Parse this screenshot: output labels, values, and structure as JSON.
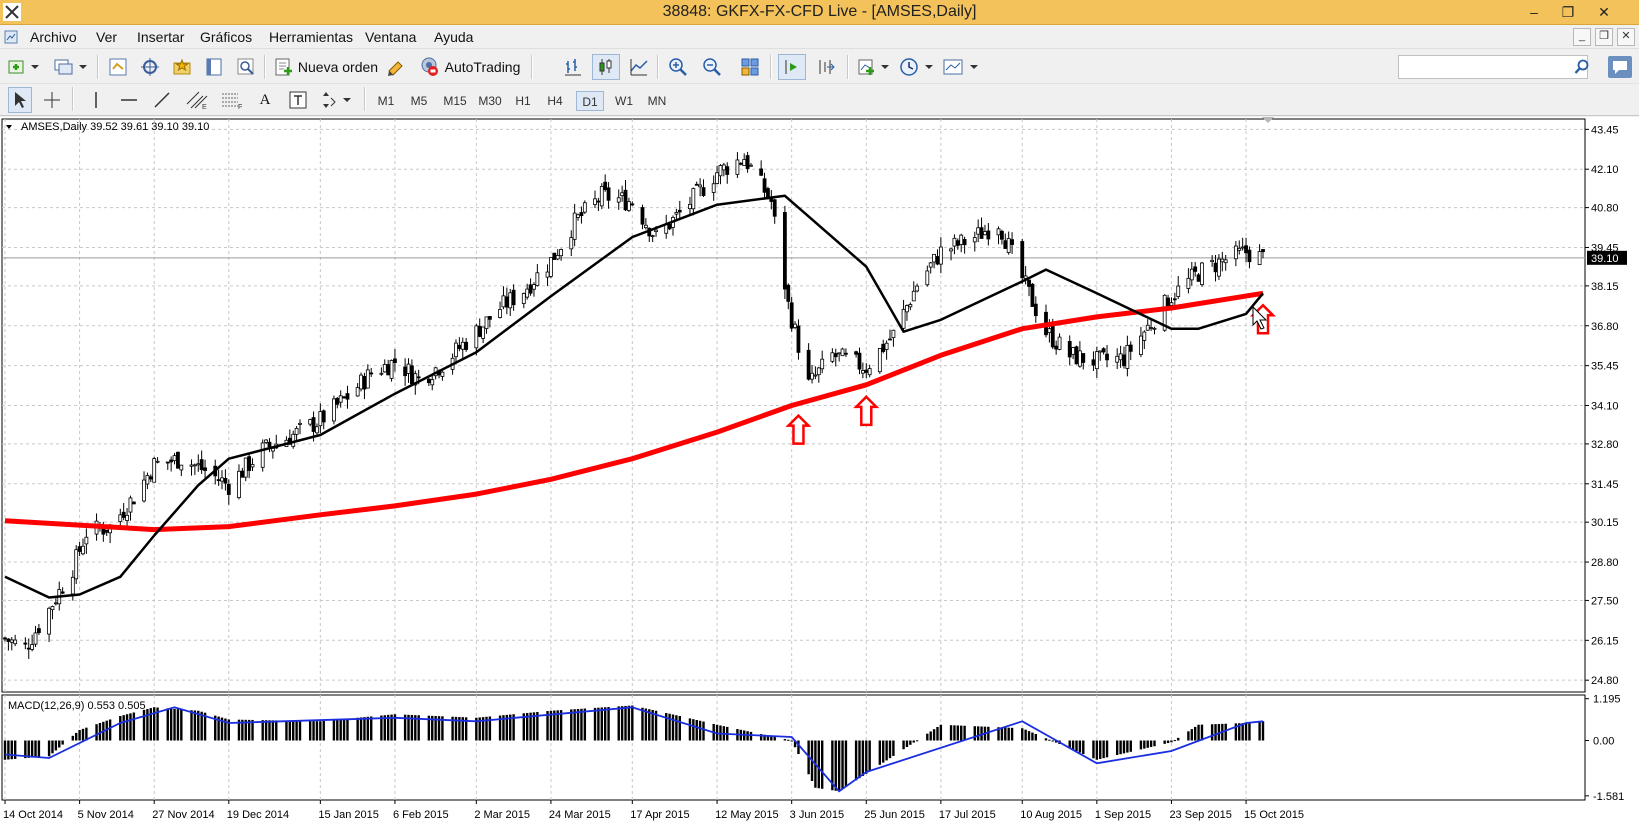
{
  "window": {
    "title": "38848: GKFX-FX-CFD Live - [AMSES,Daily]",
    "minimize": "–",
    "restore": "❐",
    "close": "✕"
  },
  "menu": {
    "items": [
      "Archivo",
      "Ver",
      "Insertar",
      "Gráficos",
      "Herramientas",
      "Ventana",
      "Ayuda"
    ]
  },
  "toolbar": {
    "new_order": "Nueva orden",
    "autotrading": "AutoTrading",
    "text_tool": "A",
    "timeframes": [
      "M1",
      "M5",
      "M15",
      "M30",
      "H1",
      "H4",
      "D1",
      "W1",
      "MN"
    ],
    "active_timeframe": "D1"
  },
  "chart": {
    "info_label": "AMSES,Daily  39.52 39.61 39.10 39.10",
    "current_price": "39.10",
    "price_ticks": [
      "43.45",
      "42.10",
      "40.80",
      "39.45",
      "38.15",
      "36.80",
      "35.45",
      "34.10",
      "32.80",
      "31.45",
      "30.15",
      "28.80",
      "27.50",
      "26.15",
      "24.80"
    ],
    "macd_label": "MACD(12,26,9) 0.553 0.505",
    "macd_ticks": [
      "1.195",
      "0.00",
      "-1.581"
    ],
    "date_ticks": [
      "14 Oct 2014",
      "5 Nov 2014",
      "27 Nov 2014",
      "19 Dec 2014",
      "15 Jan 2015",
      "6 Feb 2015",
      "2 Mar 2015",
      "24 Mar 2015",
      "17 Apr 2015",
      "12 May 2015",
      "3 Jun 2015",
      "25 Jun 2015",
      "17 Jul 2015",
      "10 Aug 2015",
      "1 Sep 2015",
      "23 Sep 2015",
      "15 Oct 2015"
    ],
    "colors": {
      "sma_slow": "#ff0000",
      "sma_fast": "#000000",
      "macd_signal": "#1a2ee0",
      "arrows": "#ff0000",
      "grid": "#c8c8c8"
    }
  },
  "chart_data": {
    "type": "candlestick",
    "symbol": "AMSES",
    "timeframe": "Daily",
    "last_ohlc": {
      "open": 39.52,
      "high": 39.61,
      "low": 39.1,
      "close": 39.1
    },
    "ylim": [
      24.4,
      43.8
    ],
    "close_path": [
      [
        "14 Oct 2014",
        26.2
      ],
      [
        "20 Oct 2014",
        25.9
      ],
      [
        "27 Oct 2014",
        27.2
      ],
      [
        "3 Nov 2014",
        28.6
      ],
      [
        "7 Nov 2014",
        29.8
      ],
      [
        "14 Nov 2014",
        30.0
      ],
      [
        "21 Nov 2014",
        31.0
      ],
      [
        "27 Nov 2014",
        32.1
      ],
      [
        "5 Dec 2014",
        32.3
      ],
      [
        "12 Dec 2014",
        31.9
      ],
      [
        "19 Dec 2014",
        31.4
      ],
      [
        "29 Dec 2014",
        32.6
      ],
      [
        "7 Jan 2015",
        33.1
      ],
      [
        "15 Jan 2015",
        33.6
      ],
      [
        "23 Jan 2015",
        34.4
      ],
      [
        "30 Jan 2015",
        35.2
      ],
      [
        "6 Feb 2015",
        35.6
      ],
      [
        "13 Feb 2015",
        35.0
      ],
      [
        "20 Feb 2015",
        35.5
      ],
      [
        "2 Mar 2015",
        36.6
      ],
      [
        "9 Mar 2015",
        37.4
      ],
      [
        "16 Mar 2015",
        38.0
      ],
      [
        "24 Mar 2015",
        39.0
      ],
      [
        "31 Mar 2015",
        40.3
      ],
      [
        "8 Apr 2015",
        41.2
      ],
      [
        "17 Apr 2015",
        41.0
      ],
      [
        "24 Apr 2015",
        39.8
      ],
      [
        "1 May 2015",
        40.6
      ],
      [
        "12 May 2015",
        42.0
      ],
      [
        "20 May 2015",
        42.5
      ],
      [
        "28 May 2015",
        41.0
      ],
      [
        "2 Jun 2015",
        37.5
      ],
      [
        "8 Jun 2015",
        34.8
      ],
      [
        "15 Jun 2015",
        35.8
      ],
      [
        "25 Jun 2015",
        35.4
      ],
      [
        "3 Jul 2015",
        36.5
      ],
      [
        "10 Jul 2015",
        38.2
      ],
      [
        "17 Jul 2015",
        39.3
      ],
      [
        "27 Jul 2015",
        39.8
      ],
      [
        "3 Aug 2015",
        40.3
      ],
      [
        "10 Aug 2015",
        38.4
      ],
      [
        "17 Aug 2015",
        36.6
      ],
      [
        "24 Aug 2015",
        35.8
      ],
      [
        "1 Sep 2015",
        35.6
      ],
      [
        "9 Sep 2015",
        35.7
      ],
      [
        "17 Sep 2015",
        36.9
      ],
      [
        "23 Sep 2015",
        37.8
      ],
      [
        "1 Oct 2015",
        38.6
      ],
      [
        "8 Oct 2015",
        39.0
      ],
      [
        "15 Oct 2015",
        39.3
      ],
      [
        "20 Oct 2015",
        39.1
      ]
    ],
    "series": [
      {
        "name": "sma_slow",
        "points": [
          [
            "14 Oct 2014",
            30.2
          ],
          [
            "27 Nov 2014",
            29.9
          ],
          [
            "19 Dec 2014",
            30.0
          ],
          [
            "15 Jan 2015",
            30.4
          ],
          [
            "6 Feb 2015",
            30.7
          ],
          [
            "2 Mar 2015",
            31.1
          ],
          [
            "24 Mar 2015",
            31.6
          ],
          [
            "17 Apr 2015",
            32.3
          ],
          [
            "12 May 2015",
            33.2
          ],
          [
            "3 Jun 2015",
            34.1
          ],
          [
            "25 Jun 2015",
            34.8
          ],
          [
            "17 Jul 2015",
            35.8
          ],
          [
            "10 Aug 2015",
            36.7
          ],
          [
            "1 Sep 2015",
            37.1
          ],
          [
            "23 Sep 2015",
            37.4
          ],
          [
            "20 Oct 2015",
            37.9
          ]
        ]
      },
      {
        "name": "sma_fast",
        "points": [
          [
            "14 Oct 2014",
            28.3
          ],
          [
            "27 Oct 2014",
            27.6
          ],
          [
            "5 Nov 2014",
            27.7
          ],
          [
            "17 Nov 2014",
            28.3
          ],
          [
            "27 Nov 2014",
            29.7
          ],
          [
            "10 Dec 2014",
            31.4
          ],
          [
            "19 Dec 2014",
            32.3
          ],
          [
            "15 Jan 2015",
            33.1
          ],
          [
            "6 Feb 2015",
            34.5
          ],
          [
            "2 Mar 2015",
            35.9
          ],
          [
            "24 Mar 2015",
            37.8
          ],
          [
            "17 Apr 2015",
            39.8
          ],
          [
            "12 May 2015",
            40.9
          ],
          [
            "1 Jun 2015",
            41.2
          ],
          [
            "25 Jun 2015",
            38.8
          ],
          [
            "6 Jul 2015",
            36.6
          ],
          [
            "17 Jul 2015",
            37.0
          ],
          [
            "10 Aug 2015",
            38.3
          ],
          [
            "17 Aug 2015",
            38.7
          ],
          [
            "1 Sep 2015",
            37.9
          ],
          [
            "23 Sep 2015",
            36.7
          ],
          [
            "1 Oct 2015",
            36.7
          ],
          [
            "15 Oct 2015",
            37.2
          ],
          [
            "20 Oct 2015",
            37.9
          ]
        ]
      }
    ],
    "macd": {
      "ylim": [
        -1.7,
        1.3
      ],
      "histogram": [
        [
          "14 Oct 2014",
          -0.55
        ],
        [
          "27 Oct 2014",
          -0.45
        ],
        [
          "5 Nov 2014",
          0.3
        ],
        [
          "17 Nov 2014",
          0.7
        ],
        [
          "27 Nov 2014",
          0.95
        ],
        [
          "10 Dec 2014",
          0.85
        ],
        [
          "19 Dec 2014",
          0.6
        ],
        [
          "15 Jan 2015",
          0.55
        ],
        [
          "6 Feb 2015",
          0.75
        ],
        [
          "2 Mar 2015",
          0.65
        ],
        [
          "24 Mar 2015",
          0.85
        ],
        [
          "17 Apr 2015",
          1.0
        ],
        [
          "1 May 2015",
          0.7
        ],
        [
          "12 May 2015",
          0.45
        ],
        [
          "3 Jun 2015",
          0.0
        ],
        [
          "10 Jun 2015",
          -1.35
        ],
        [
          "17 Jun 2015",
          -1.45
        ],
        [
          "25 Jun 2015",
          -0.95
        ],
        [
          "17 Jul 2015",
          0.45
        ],
        [
          "10 Aug 2015",
          0.35
        ],
        [
          "1 Sep 2015",
          -0.55
        ],
        [
          "23 Sep 2015",
          -0.05
        ],
        [
          "1 Oct 2015",
          0.45
        ],
        [
          "15 Oct 2015",
          0.5
        ],
        [
          "20 Oct 2015",
          0.55
        ]
      ],
      "signal": [
        [
          "14 Oct 2014",
          -0.4
        ],
        [
          "27 Oct 2014",
          -0.5
        ],
        [
          "17 Nov 2014",
          0.5
        ],
        [
          "3 Dec 2014",
          0.95
        ],
        [
          "19 Dec 2014",
          0.5
        ],
        [
          "6 Feb 2015",
          0.65
        ],
        [
          "2 Mar 2015",
          0.55
        ],
        [
          "17 Apr 2015",
          0.95
        ],
        [
          "12 May 2015",
          0.2
        ],
        [
          "3 Jun 2015",
          0.1
        ],
        [
          "17 Jun 2015",
          -1.45
        ],
        [
          "25 Jun 2015",
          -0.9
        ],
        [
          "10 Aug 2015",
          0.55
        ],
        [
          "1 Sep 2015",
          -0.65
        ],
        [
          "23 Sep 2015",
          -0.3
        ],
        [
          "15 Oct 2015",
          0.5
        ],
        [
          "20 Oct 2015",
          0.55
        ]
      ]
    },
    "arrows": [
      "5 Jun 2015",
      "25 Jun 2015",
      "20 Oct 2015"
    ]
  }
}
